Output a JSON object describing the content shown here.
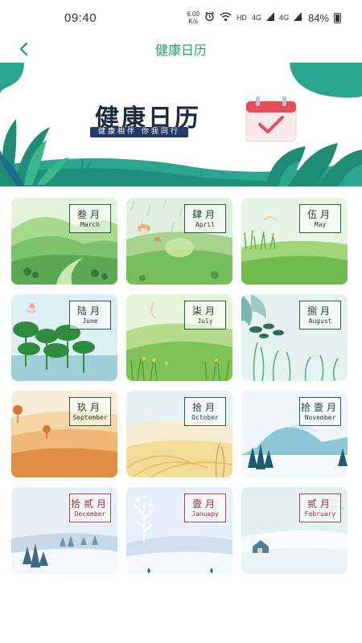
{
  "status_bar": {
    "time": "09:40",
    "net_speed_value": "6.00",
    "net_speed_unit": "K/s",
    "hd": "HD",
    "signal_1": "4G",
    "signal_2": "4G",
    "battery": "84%"
  },
  "nav": {
    "title": "健康日历",
    "back_icon": "chevron-left-icon"
  },
  "banner": {
    "title": "健康日历",
    "slogan": "健康相伴  你我同行",
    "calendar_icon": "calendar-check-icon"
  },
  "months": [
    {
      "cn": "叁月",
      "en": "March",
      "theme": "spring-hills"
    },
    {
      "cn": "肆月",
      "en": "April",
      "theme": "spring-rain"
    },
    {
      "cn": "伍月",
      "en": "May",
      "theme": "meadow"
    },
    {
      "cn": "陆月",
      "en": "June",
      "theme": "lotus-pond"
    },
    {
      "cn": "柒月",
      "en": "July",
      "theme": "summer-hills"
    },
    {
      "cn": "捌月",
      "en": "August",
      "theme": "reeds"
    },
    {
      "cn": "玖月",
      "en": "September",
      "theme": "autumn-field"
    },
    {
      "cn": "拾月",
      "en": "October",
      "theme": "reed-sunset"
    },
    {
      "cn": "拾壹月",
      "en": "November",
      "theme": "snowy-mountain"
    },
    {
      "cn": "拾贰月",
      "en": "December",
      "theme": "winter-forest"
    },
    {
      "cn": "壹月",
      "en": "Januapy",
      "theme": "snow-trees"
    },
    {
      "cn": "贰月",
      "en": "February",
      "theme": "snow-house"
    }
  ],
  "colors": {
    "accent": "#2a9d6e",
    "label_border_green": "#2f5d46",
    "label_border_red": "#b6424a"
  }
}
